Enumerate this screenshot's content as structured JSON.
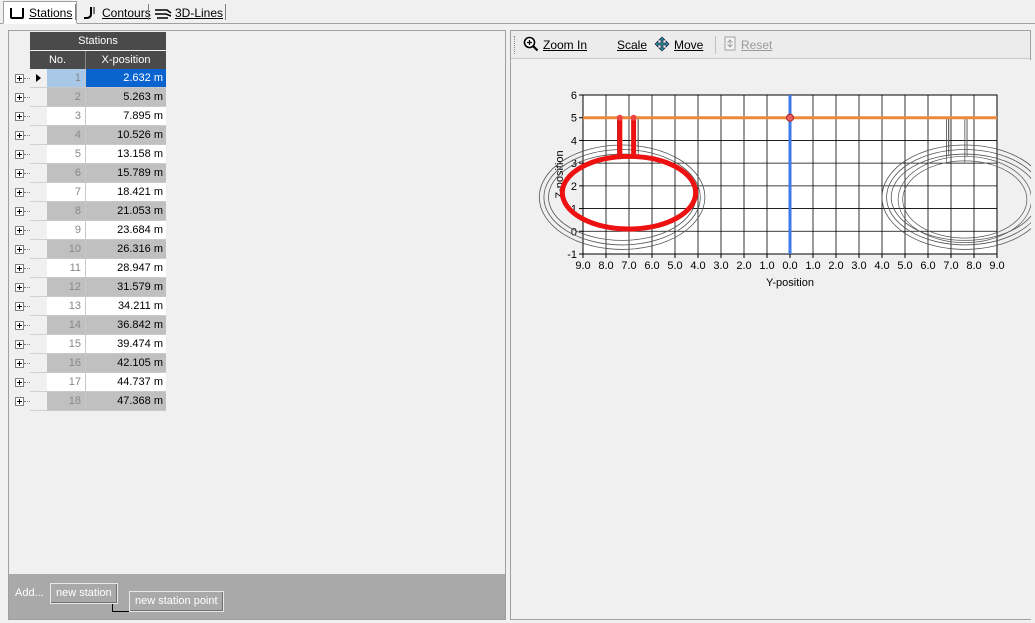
{
  "tabs": [
    {
      "label": "Stations",
      "icon": "stations-icon",
      "active": true
    },
    {
      "label": "Contours",
      "icon": "contours-icon",
      "active": false
    },
    {
      "label": "3D-Lines",
      "icon": "3d-lines-icon",
      "active": false
    }
  ],
  "stations_table": {
    "title": "Stations",
    "col_no": "No.",
    "col_x": "X-position",
    "rows": [
      {
        "no": "1",
        "x": "2.632 m"
      },
      {
        "no": "2",
        "x": "5.263 m"
      },
      {
        "no": "3",
        "x": "7.895 m"
      },
      {
        "no": "4",
        "x": "10.526 m"
      },
      {
        "no": "5",
        "x": "13.158 m"
      },
      {
        "no": "6",
        "x": "15.789 m"
      },
      {
        "no": "7",
        "x": "18.421 m"
      },
      {
        "no": "8",
        "x": "21.053 m"
      },
      {
        "no": "9",
        "x": "23.684 m"
      },
      {
        "no": "10",
        "x": "26.316 m"
      },
      {
        "no": "11",
        "x": "28.947 m"
      },
      {
        "no": "12",
        "x": "31.579 m"
      },
      {
        "no": "13",
        "x": "34.211 m"
      },
      {
        "no": "14",
        "x": "36.842 m"
      },
      {
        "no": "15",
        "x": "39.474 m"
      },
      {
        "no": "16",
        "x": "42.105 m"
      },
      {
        "no": "17",
        "x": "44.737 m"
      },
      {
        "no": "18",
        "x": "47.368 m"
      }
    ],
    "selected_row": 1
  },
  "add_bar": {
    "label": "Add...",
    "new_station": "new station",
    "new_station_point": "new station point"
  },
  "toolbar": {
    "zoom_in": "Zoom In",
    "scale": "Scale",
    "move": "Move",
    "reset": "Reset"
  },
  "chart_data": {
    "type": "line",
    "xlabel": "Y-position",
    "ylabel": "Z-position",
    "xticks": [
      "9.0",
      "8.0",
      "7.0",
      "6.0",
      "5.0",
      "4.0",
      "3.0",
      "2.0",
      "1.0",
      "0.0",
      "1.0",
      "2.0",
      "3.0",
      "4.0",
      "5.0",
      "6.0",
      "7.0",
      "8.0",
      "9.0"
    ],
    "yticks": [
      "-1",
      "0",
      "1",
      "2",
      "3",
      "4",
      "5",
      "6"
    ],
    "xlim": [
      -9,
      9
    ],
    "ylim": [
      -1,
      6
    ],
    "grid": true,
    "horizontal_line_z": 5,
    "vertical_line_y": 0,
    "colors": {
      "waterline": "#f0883c",
      "centerline": "#3c7ae6",
      "selected_section": "#ee1111",
      "sections": "#555555"
    }
  }
}
